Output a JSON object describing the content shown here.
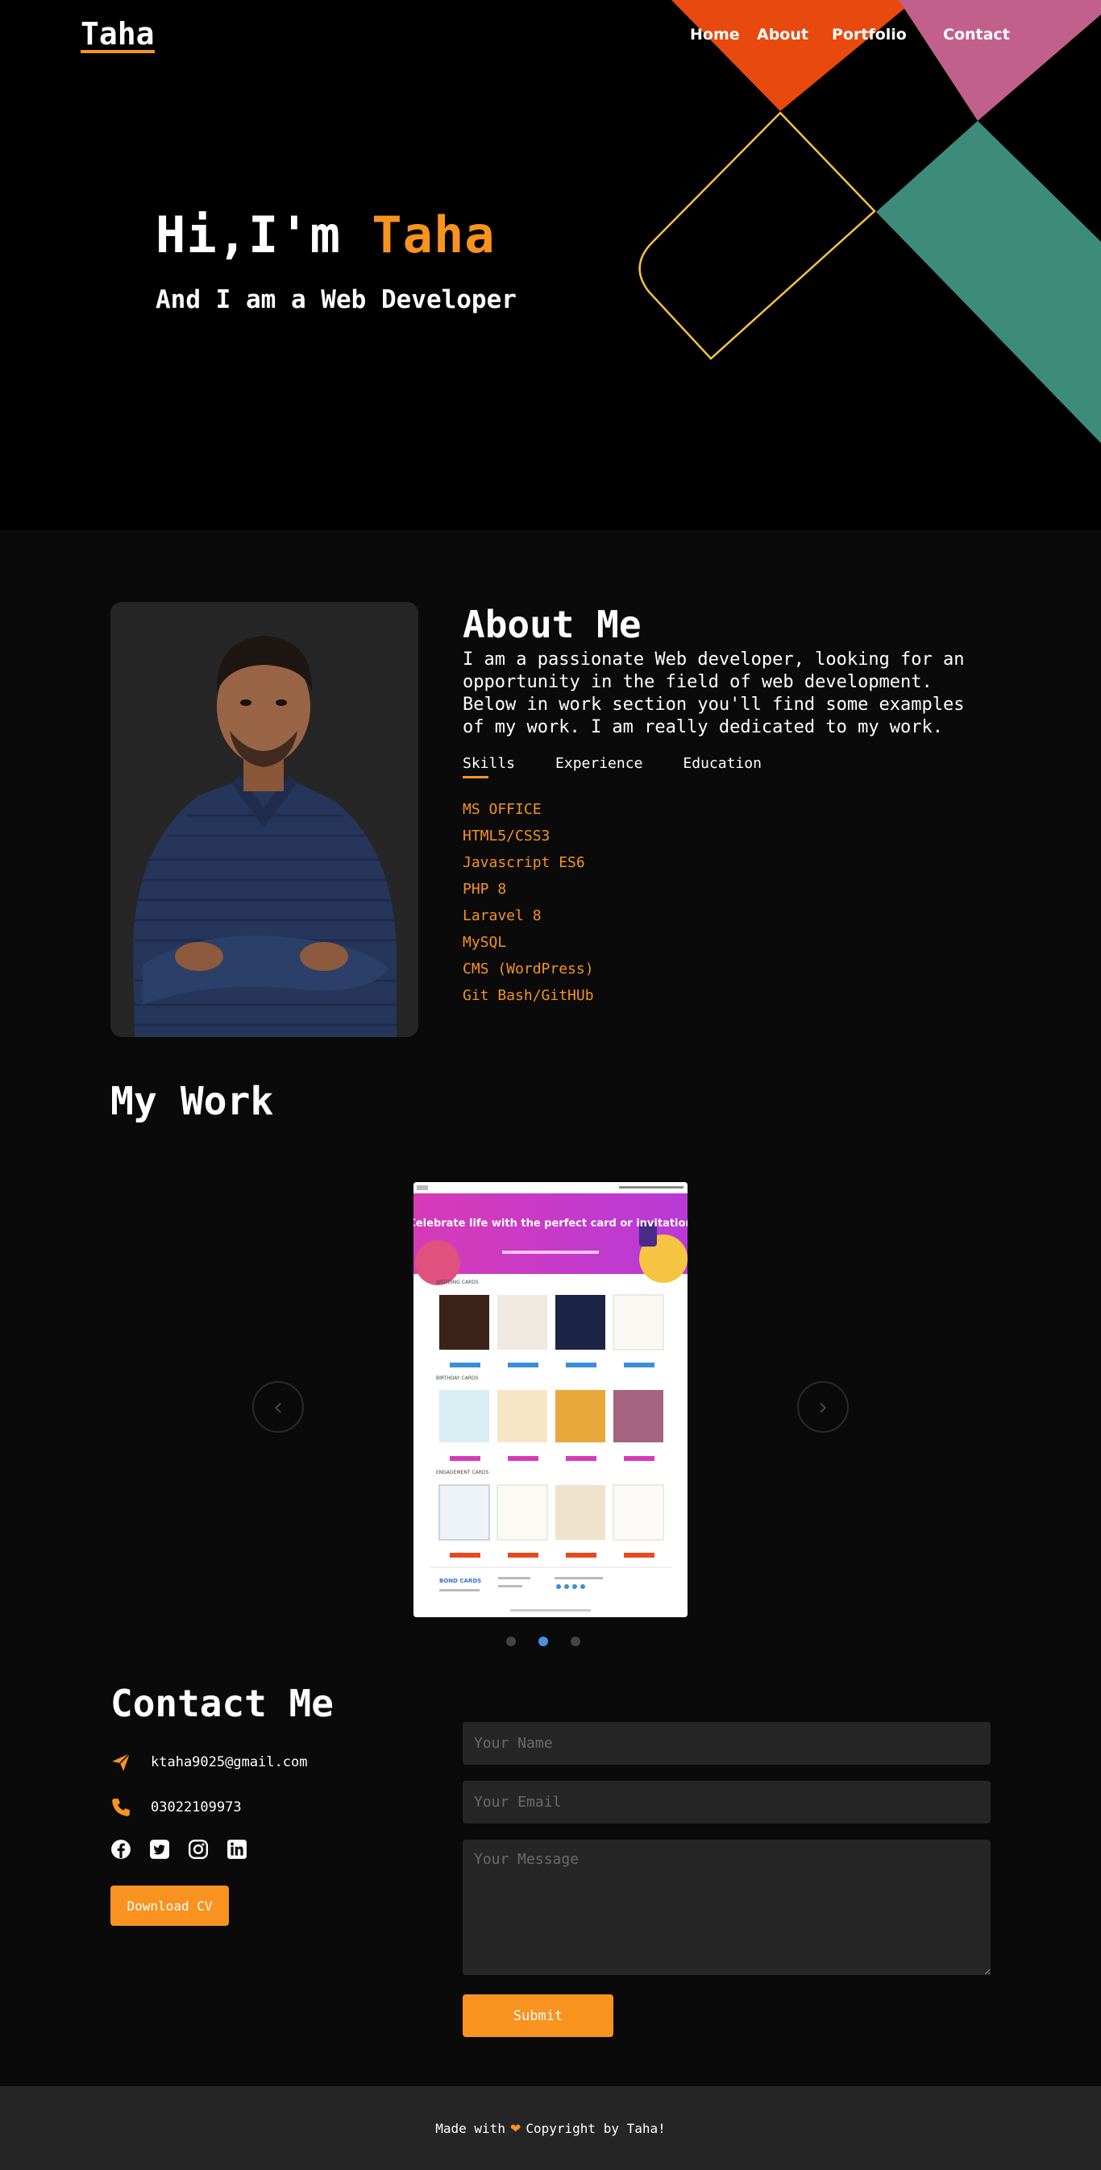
{
  "nav": {
    "logo": "Taha",
    "links": [
      "Home",
      "About",
      "Portfolio",
      "Contact"
    ]
  },
  "hero": {
    "greeting": "Hi,I'm ",
    "name": "Taha",
    "subtitle": "And I am a Web Developer"
  },
  "about": {
    "title": "About Me",
    "description": "I am a passionate Web developer, looking for an opportunity in the field of web development. Below in work section you'll find some examples of my work. I am really dedicated to my work.",
    "tabs": [
      "Skills",
      "Experience",
      "Education"
    ],
    "skills": [
      "MS OFFICE",
      "HTML5/CSS3",
      "Javascript ES6",
      "PHP 8",
      "Laravel 8",
      "MySQL",
      "CMS (WordPress)",
      "Git Bash/GitHUb"
    ]
  },
  "work": {
    "title": "My Work",
    "slide": {
      "banner_text": "Celebrate life with the perfect card or invitation",
      "sections": [
        "WEDDING CARDS",
        "BIRTHDAY CARDS",
        "ENGAGEMENT CARDS"
      ],
      "footer_logo": "BOND CARDS"
    },
    "slides_count": 3,
    "active_slide": 1
  },
  "contact": {
    "title": "Contact Me",
    "email": "ktaha9025@gmail.com",
    "phone": "03022109973",
    "socials": [
      "facebook-icon",
      "twitter-icon",
      "instagram-icon",
      "linkedin-icon"
    ],
    "cv_button": "Download CV",
    "form": {
      "name_placeholder": "Your Name",
      "email_placeholder": "Your Email",
      "message_placeholder": "Your Message",
      "submit": "Submit"
    }
  },
  "footer": {
    "made_with": "Made with",
    "copyright": "Copyright by Taha!"
  },
  "colors": {
    "accent": "#f7931e",
    "shape_orange": "#e8490f",
    "shape_pink": "#c2608c",
    "shape_teal": "#3d8c7a",
    "shape_yellow": "#f5c242"
  }
}
